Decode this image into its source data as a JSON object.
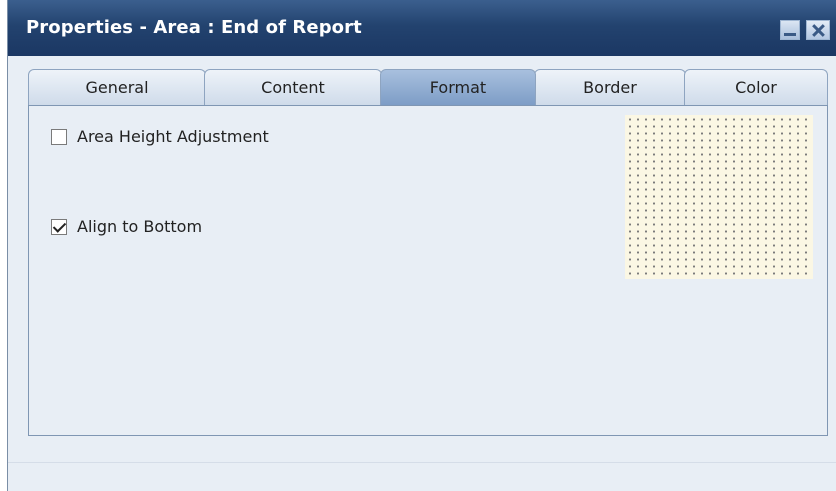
{
  "window": {
    "title": "Properties - Area : End of Report",
    "buttons": {
      "minimize": "minimize",
      "close": "close"
    }
  },
  "tabs": [
    {
      "label": "General",
      "active": false
    },
    {
      "label": "Content",
      "active": false
    },
    {
      "label": "Format",
      "active": true
    },
    {
      "label": "Border",
      "active": false
    },
    {
      "label": "Color",
      "active": false
    }
  ],
  "format": {
    "area_height_adjustment": {
      "label": "Area Height Adjustment",
      "checked": false
    },
    "align_to_bottom": {
      "label": "Align to Bottom",
      "checked": true
    }
  },
  "colors": {
    "titlebar": "#23436f",
    "active_tab": "#8fabd2",
    "panel_bg": "#e8eef5",
    "preview_bg": "#fbf7e4"
  }
}
